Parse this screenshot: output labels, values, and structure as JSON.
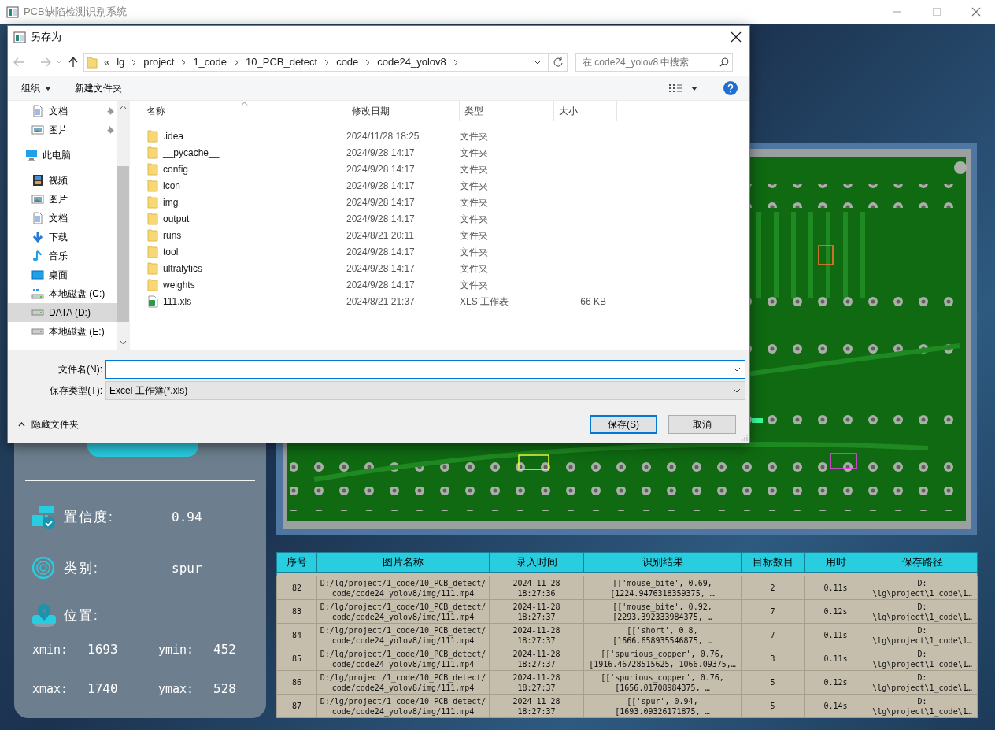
{
  "app": {
    "title": "PCB缺陷检测识别系统"
  },
  "results": {
    "fields": [
      {
        "kind": "confidence",
        "label": "置信度:",
        "value": "0.94"
      },
      {
        "kind": "class",
        "label": "类别:",
        "value": "spur"
      },
      {
        "kind": "location",
        "label": "位置:"
      }
    ],
    "coords": [
      {
        "label": "xmin:",
        "value": "1693"
      },
      {
        "label": "ymin:",
        "value": "452"
      },
      {
        "label": "xmax:",
        "value": "1740"
      },
      {
        "label": "ymax:",
        "value": "528"
      }
    ]
  },
  "table": {
    "columns": [
      "序号",
      "图片名称",
      "录入时间",
      "识别结果",
      "目标数目",
      "用时",
      "保存路径"
    ],
    "rows": [
      [
        [
          "82"
        ],
        [
          "D:/lg/project/1_code/10_PCB_detect/",
          "code/code24_yolov8/img/111.mp4"
        ],
        [
          "2024-11-28",
          "18:27:36"
        ],
        [
          "[['mouse_bite', 0.69,",
          "[1224.9476318359375, …"
        ],
        [
          "2"
        ],
        [
          "0.11s"
        ],
        [
          "D:",
          "\\lg\\project\\1_code\\1…"
        ]
      ],
      [
        [
          "83"
        ],
        [
          "D:/lg/project/1_code/10_PCB_detect/",
          "code/code24_yolov8/img/111.mp4"
        ],
        [
          "2024-11-28",
          "18:27:37"
        ],
        [
          "[['mouse_bite', 0.92,",
          "[2293.392333984375, …"
        ],
        [
          "7"
        ],
        [
          "0.12s"
        ],
        [
          "D:",
          "\\lg\\project\\1_code\\1…"
        ]
      ],
      [
        [
          "84"
        ],
        [
          "D:/lg/project/1_code/10_PCB_detect/",
          "code/code24_yolov8/img/111.mp4"
        ],
        [
          "2024-11-28",
          "18:27:37"
        ],
        [
          "[['short', 0.8,",
          "[1666.658935546875, …"
        ],
        [
          "7"
        ],
        [
          "0.11s"
        ],
        [
          "D:",
          "\\lg\\project\\1_code\\1…"
        ]
      ],
      [
        [
          "85"
        ],
        [
          "D:/lg/project/1_code/10_PCB_detect/",
          "code/code24_yolov8/img/111.mp4"
        ],
        [
          "2024-11-28",
          "18:27:37"
        ],
        [
          "[['spurious_copper', 0.76,",
          "[1916.46728515625, 1066.09375,…"
        ],
        [
          "3"
        ],
        [
          "0.11s"
        ],
        [
          "D:",
          "\\lg\\project\\1_code\\1…"
        ]
      ],
      [
        [
          "86"
        ],
        [
          "D:/lg/project/1_code/10_PCB_detect/",
          "code/code24_yolov8/img/111.mp4"
        ],
        [
          "2024-11-28",
          "18:27:37"
        ],
        [
          "[['spurious_copper', 0.76,",
          "[1656.01708984375, …"
        ],
        [
          "5"
        ],
        [
          "0.12s"
        ],
        [
          "D:",
          "\\lg\\project\\1_code\\1…"
        ]
      ],
      [
        [
          "87"
        ],
        [
          "D:/lg/project/1_code/10_PCB_detect/",
          "code/code24_yolov8/img/111.mp4"
        ],
        [
          "2024-11-28",
          "18:27:37"
        ],
        [
          "[['spur', 0.94,",
          "[1693.09326171875, …"
        ],
        [
          "5"
        ],
        [
          "0.14s"
        ],
        [
          "D:",
          "\\lg\\project\\1_code\\1…"
        ]
      ]
    ]
  },
  "dialog": {
    "title": "另存为",
    "path": {
      "overflow": "«",
      "segments": [
        "lg",
        "project",
        "1_code",
        "10_PCB_detect",
        "code",
        "code24_yolov8"
      ]
    },
    "search": {
      "placeholder": "在 code24_yolov8 中搜索"
    },
    "toolbar": {
      "organize": "组织",
      "new_folder": "新建文件夹"
    },
    "nav": [
      {
        "label": "文档",
        "kind": "document",
        "pinned": true,
        "selected": false
      },
      {
        "label": "图片",
        "kind": "pictures",
        "pinned": true,
        "selected": false
      },
      {
        "label": "此电脑",
        "kind": "computer",
        "pinned": false,
        "selected": false,
        "children": [
          {
            "label": "视频",
            "kind": "video",
            "pinned": false,
            "selected": false
          },
          {
            "label": "图片",
            "kind": "pictures",
            "pinned": false,
            "selected": false
          },
          {
            "label": "文档",
            "kind": "document",
            "pinned": false,
            "selected": false
          },
          {
            "label": "下载",
            "kind": "download",
            "pinned": false,
            "selected": false
          },
          {
            "label": "音乐",
            "kind": "music",
            "pinned": false,
            "selected": false
          },
          {
            "label": "桌面",
            "kind": "desktop",
            "pinned": false,
            "selected": false
          },
          {
            "label": "本地磁盘 (C:)",
            "kind": "system-drive",
            "pinned": false,
            "selected": false
          },
          {
            "label": "DATA (D:)",
            "kind": "drive",
            "pinned": false,
            "selected": true
          },
          {
            "label": "本地磁盘 (E:)",
            "kind": "drive",
            "pinned": false,
            "selected": false
          }
        ]
      }
    ],
    "columns": [
      {
        "label": "名称",
        "sorted": true
      },
      {
        "label": "修改日期",
        "sorted": false
      },
      {
        "label": "类型",
        "sorted": false
      },
      {
        "label": "大小",
        "sorted": false
      }
    ],
    "files": [
      {
        "name": ".idea",
        "date": "2024/11/28 18:25",
        "type": "文件夹",
        "kind": "folder"
      },
      {
        "name": "__pycache__",
        "date": "2024/9/28 14:17",
        "type": "文件夹",
        "kind": "folder"
      },
      {
        "name": "config",
        "date": "2024/9/28 14:17",
        "type": "文件夹",
        "kind": "folder"
      },
      {
        "name": "icon",
        "date": "2024/9/28 14:17",
        "type": "文件夹",
        "kind": "folder"
      },
      {
        "name": "img",
        "date": "2024/9/28 14:17",
        "type": "文件夹",
        "kind": "folder"
      },
      {
        "name": "output",
        "date": "2024/9/28 14:17",
        "type": "文件夹",
        "kind": "folder"
      },
      {
        "name": "runs",
        "date": "2024/8/21 20:11",
        "type": "文件夹",
        "kind": "folder"
      },
      {
        "name": "tool",
        "date": "2024/9/28 14:17",
        "type": "文件夹",
        "kind": "folder"
      },
      {
        "name": "ultralytics",
        "date": "2024/9/28 14:17",
        "type": "文件夹",
        "kind": "folder"
      },
      {
        "name": "weights",
        "date": "2024/9/28 14:17",
        "type": "文件夹",
        "kind": "folder"
      },
      {
        "name": "111.xls",
        "date": "2024/8/21 21:37",
        "type": "XLS 工作表",
        "size": "66 KB",
        "kind": "spreadsheet"
      }
    ],
    "filename": {
      "label": "文件名(N):"
    },
    "filetype": {
      "label": "保存类型(T):",
      "value": "Excel 工作簿(*.xls)"
    },
    "hide_folders": "隐藏文件夹",
    "buttons": [
      {
        "label": "保存(S)",
        "default": true
      },
      {
        "label": "取消",
        "default": false
      }
    ]
  }
}
